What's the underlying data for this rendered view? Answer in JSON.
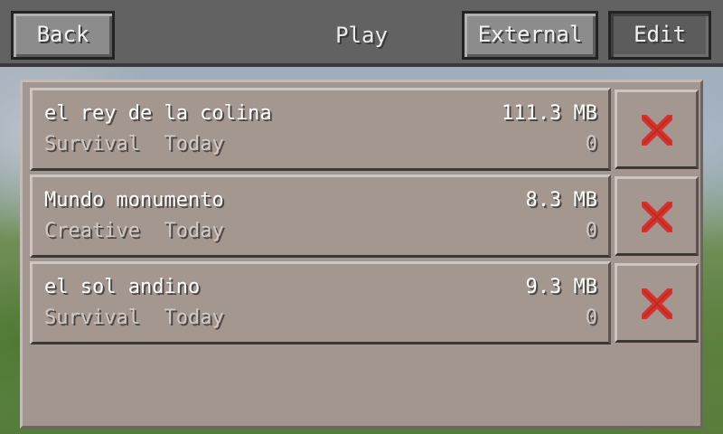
{
  "header": {
    "back_label": "Back",
    "title": "Play",
    "external_label": "External",
    "edit_label": "Edit"
  },
  "worlds": [
    {
      "name": "el rey de la colina",
      "size": "111.3 MB",
      "mode": "Survival",
      "date": "Today",
      "count": "0"
    },
    {
      "name": "Mundo monumento",
      "size": "8.3 MB",
      "mode": "Creative",
      "date": "Today",
      "count": "0"
    },
    {
      "name": "el sol andino",
      "size": "9.3 MB",
      "mode": "Survival",
      "date": "Today",
      "count": "0"
    }
  ],
  "icons": {
    "delete": "delete-x-icon"
  },
  "colors": {
    "delete_x": "#d6332b",
    "panel": "#a39690",
    "header": "#626262"
  }
}
